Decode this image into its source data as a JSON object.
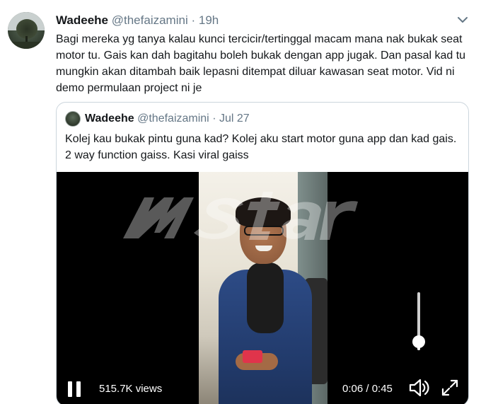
{
  "tweet": {
    "author_name": "Wadeehe",
    "author_handle": "@thefaizamini",
    "separator": "·",
    "time": "19h",
    "text": "Bagi mereka yg tanya kalau kunci tercicir/tertinggal macam mana nak bukak seat motor tu. Gais kan dah bagitahu boleh bukak dengan app jugak. Dan pasal kad tu mungkin akan ditambah baik lepasni ditempat diluar kawasan seat motor. Vid ni demo permulaan project ni je",
    "menu_icon": "chevron-down-icon"
  },
  "quoted": {
    "author_name": "Wadeehe",
    "author_handle": "@thefaizamini",
    "separator": "·",
    "time": "Jul 27",
    "text": "Kolej kau bukak pintu guna kad? Kolej aku start motor guna app dan kad gais. 2 way function gaiss. Kasi viral gaiss"
  },
  "video": {
    "views": "515.7K views",
    "time": "0:06 / 0:45",
    "volume_level": 0.15,
    "icons": [
      "pause-icon",
      "volume-icon",
      "fullscreen-icon"
    ]
  },
  "colors": {
    "text": "#14171a",
    "meta": "#657786",
    "border": "#ccd6dd",
    "video_bg": "#000000"
  }
}
